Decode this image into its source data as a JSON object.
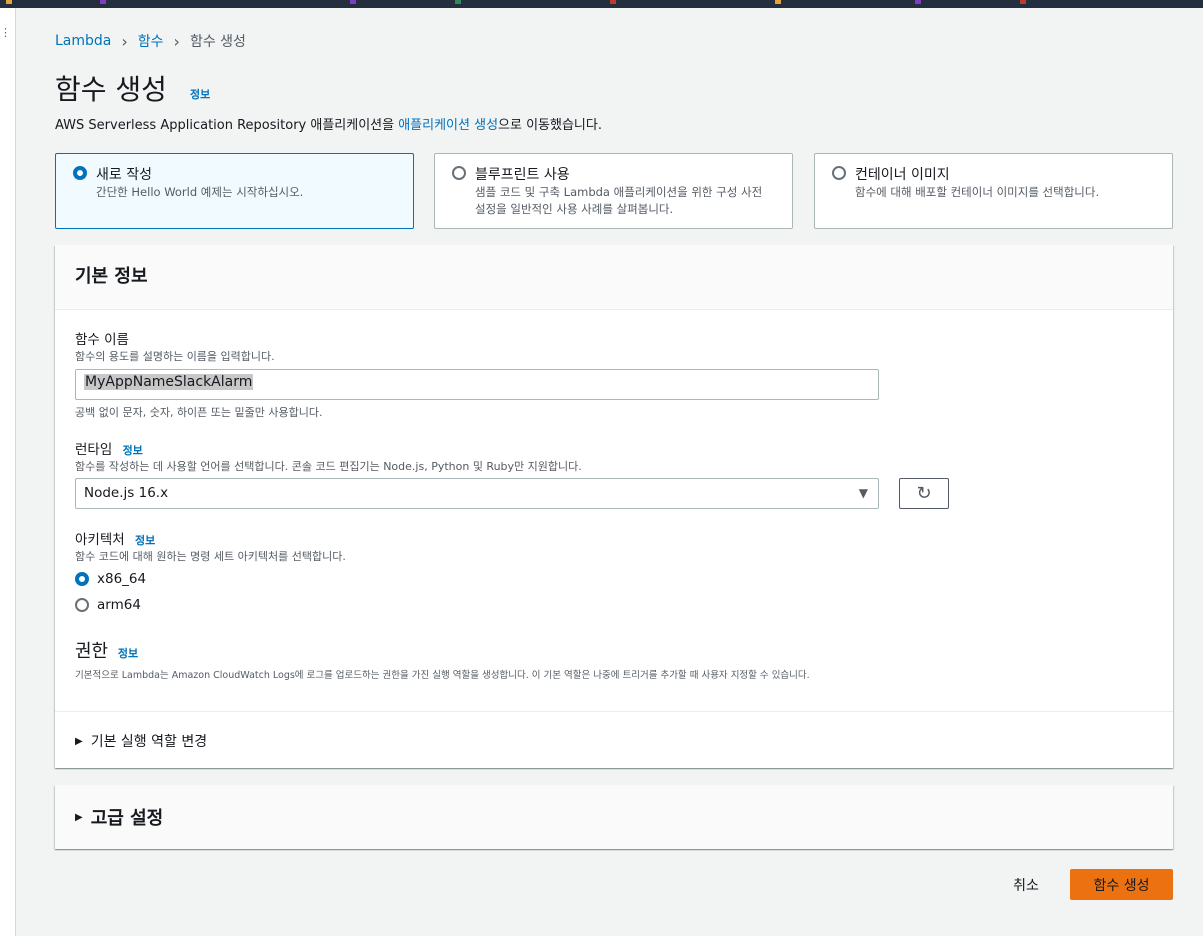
{
  "breadcrumb": {
    "lambda": "Lambda",
    "functions": "함수",
    "current": "함수 생성"
  },
  "page": {
    "title": "함수 생성",
    "info": "정보",
    "desc_prefix": "AWS Serverless Application Repository 애플리케이션을 ",
    "desc_link": "애플리케이션 생성",
    "desc_suffix": "으로 이동했습니다."
  },
  "options": [
    {
      "title": "새로 작성",
      "desc": "간단한 Hello World 예제는 시작하십시오.",
      "selected": true
    },
    {
      "title": "블루프린트 사용",
      "desc": "샘플 코드 및 구축 Lambda 애플리케이션을 위한 구성 사전 설정을 일반적인 사용 사례를 살펴봅니다.",
      "selected": false
    },
    {
      "title": "컨테이너 이미지",
      "desc": "함수에 대해 배포할 컨테이너 이미지를 선택합니다.",
      "selected": false
    }
  ],
  "basic": {
    "header": "기본 정보",
    "name_label": "함수 이름",
    "name_desc": "함수의 용도를 설명하는 이름을 입력합니다.",
    "name_value": "MyAppNameSlackAlarm",
    "name_hint": "공백 없이 문자, 숫자, 하이픈 또는 밑줄만 사용합니다.",
    "runtime_label": "런타임",
    "runtime_info": "정보",
    "runtime_desc": "함수를 작성하는 데 사용할 언어를 선택합니다. 콘솔 코드 편집기는 Node.js, Python 및 Ruby만 지원합니다.",
    "runtime_value": "Node.js 16.x",
    "arch_label": "아키텍처",
    "arch_info": "정보",
    "arch_desc": "함수 코드에 대해 원하는 명령 세트 아키텍처를 선택합니다.",
    "arch_options": [
      "x86_64",
      "arm64"
    ],
    "arch_selected": "x86_64",
    "perm_title": "권한",
    "perm_info": "정보",
    "perm_desc": "기본적으로 Lambda는 Amazon CloudWatch Logs에 로그를 업로드하는 권한을 가진 실행 역할을 생성합니다. 이 기본 역할은 나중에 트리거를 추가할 때 사용자 지정할 수 있습니다.",
    "role_expander": "기본 실행 역할 변경"
  },
  "advanced": {
    "label": "고급 설정"
  },
  "actions": {
    "cancel": "취소",
    "create": "함수 생성"
  },
  "colors": {
    "accent": "#0073bb",
    "primary_button": "#ec7211",
    "background": "#f2f3f3"
  }
}
